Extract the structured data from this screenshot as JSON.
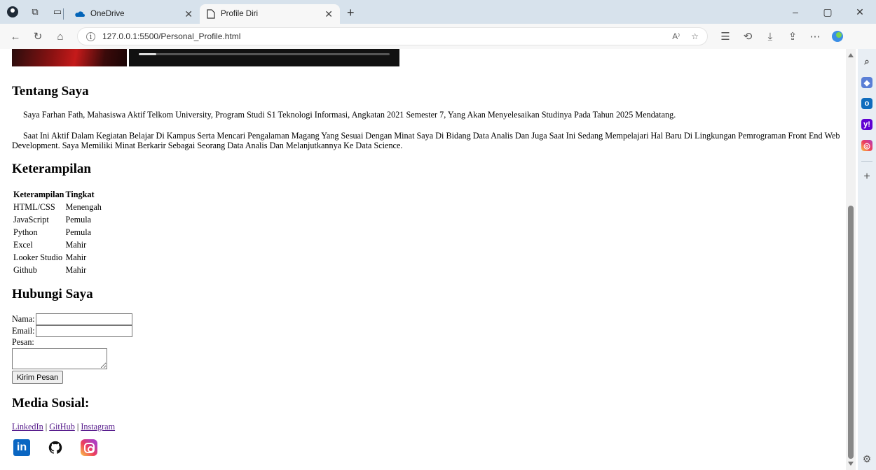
{
  "browser": {
    "tabs": [
      {
        "title": "OneDrive",
        "active": false,
        "icon": "onedrive-cloud-icon"
      },
      {
        "title": "Profile Diri",
        "active": true,
        "icon": "page-icon"
      }
    ],
    "url": "127.0.0.1:5500/Personal_Profile.html",
    "accent_color": "#d7e2ec"
  },
  "about": {
    "heading": "Tentang Saya",
    "paragraph1": "Saya Farhan Fath, Mahasiswa Aktif Telkom University, Program Studi S1 Teknologi Informasi, Angkatan 2021 Semester 7, Yang Akan Menyelesaikan Studinya Pada Tahun 2025 Mendatang.",
    "paragraph2": "Saat Ini Aktif Dalam Kegiatan Belajar Di Kampus Serta Mencari Pengalaman Magang Yang Sesuai Dengan Minat Saya Di Bidang Data Analis Dan Juga Saat Ini Sedang Mempelajari Hal Baru Di Lingkungan Pemrograman Front End Web Development. Saya Memiliki Minat Berkarir Sebagai Seorang Data Analis Dan Melanjutkannya Ke Data Science."
  },
  "skills": {
    "heading": "Keterampilan",
    "columns": [
      "Keterampilan",
      "Tingkat"
    ],
    "rows": [
      [
        "HTML/CSS",
        "Menengah"
      ],
      [
        "JavaScript",
        "Pemula"
      ],
      [
        "Python",
        "Pemula"
      ],
      [
        "Excel",
        "Mahir"
      ],
      [
        "Looker Studio",
        "Mahir"
      ],
      [
        "Github",
        "Mahir"
      ]
    ]
  },
  "contact": {
    "heading": "Hubungi Saya",
    "name_label": "Nama:",
    "email_label": "Email:",
    "message_label": "Pesan:",
    "name_value": "",
    "email_value": "",
    "submit_label": "Kirim Pesan"
  },
  "social": {
    "heading": "Media Sosial:",
    "links": [
      "LinkedIn",
      "GitHub",
      "Instagram"
    ],
    "separator": " | ",
    "icons": [
      "linkedin-icon",
      "github-icon",
      "instagram-icon"
    ],
    "colors": {
      "linkedin": "#0a66c2",
      "link": "#551a8b"
    }
  },
  "video": {
    "progress": 0.07
  }
}
